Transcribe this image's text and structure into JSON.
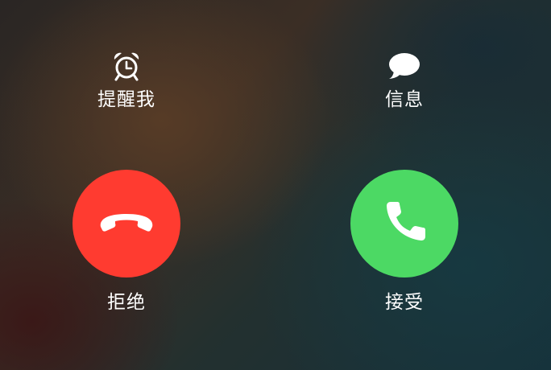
{
  "actions": {
    "remind_me": {
      "label": "提醒我",
      "icon": "alarm-clock-icon"
    },
    "message": {
      "label": "信息",
      "icon": "message-bubble-icon"
    }
  },
  "call": {
    "decline": {
      "label": "拒绝",
      "icon": "phone-hangup-icon",
      "color": "#FF3B30"
    },
    "accept": {
      "label": "接受",
      "icon": "phone-icon",
      "color": "#4CD964"
    }
  }
}
